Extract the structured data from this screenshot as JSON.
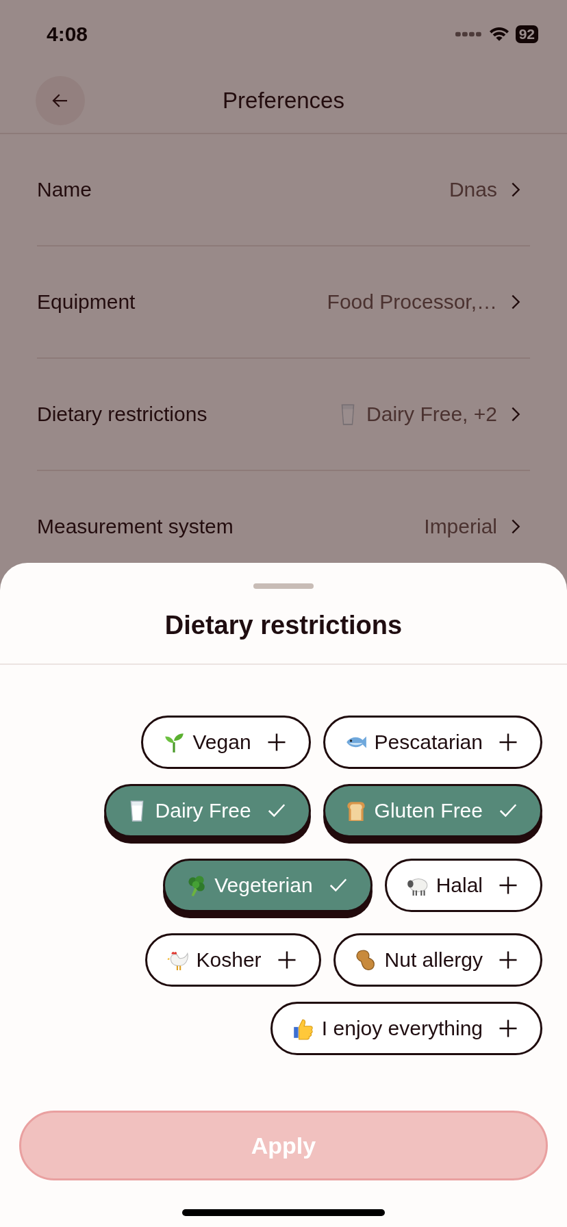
{
  "status_bar": {
    "time": "4:08",
    "battery": "92"
  },
  "nav": {
    "title": "Preferences"
  },
  "settings": [
    {
      "label": "Name",
      "value": "Dnas"
    },
    {
      "label": "Equipment",
      "value": "Food Processor,…"
    },
    {
      "label": "Dietary restrictions",
      "value": "Dairy Free, +2",
      "kind": "milk"
    },
    {
      "label": "Measurement system",
      "value": "Imperial"
    }
  ],
  "sheet": {
    "title": "Dietary restrictions",
    "chip_rows": [
      {
        "chips": [
          {
            "label": "Vegan",
            "kind": "sprout",
            "selected": false
          },
          {
            "label": "Pescatarian",
            "kind": "fish",
            "selected": false
          }
        ]
      },
      {
        "chips": [
          {
            "label": "Dairy Free",
            "kind": "milk",
            "selected": true
          },
          {
            "label": "Gluten Free",
            "kind": "bread",
            "selected": true
          }
        ]
      },
      {
        "chips": [
          {
            "label": "Vegeterian",
            "kind": "broccoli",
            "selected": true
          },
          {
            "label": "Halal",
            "kind": "sheep",
            "selected": false
          }
        ]
      },
      {
        "chips": [
          {
            "label": "Kosher",
            "kind": "rooster",
            "selected": false
          },
          {
            "label": "Nut allergy",
            "kind": "peanut",
            "selected": false
          }
        ]
      },
      {
        "chips": [
          {
            "label": "I enjoy everything",
            "kind": "thumbs",
            "selected": false
          }
        ]
      }
    ],
    "apply": {
      "label": "Apply",
      "disabled": true
    }
  }
}
